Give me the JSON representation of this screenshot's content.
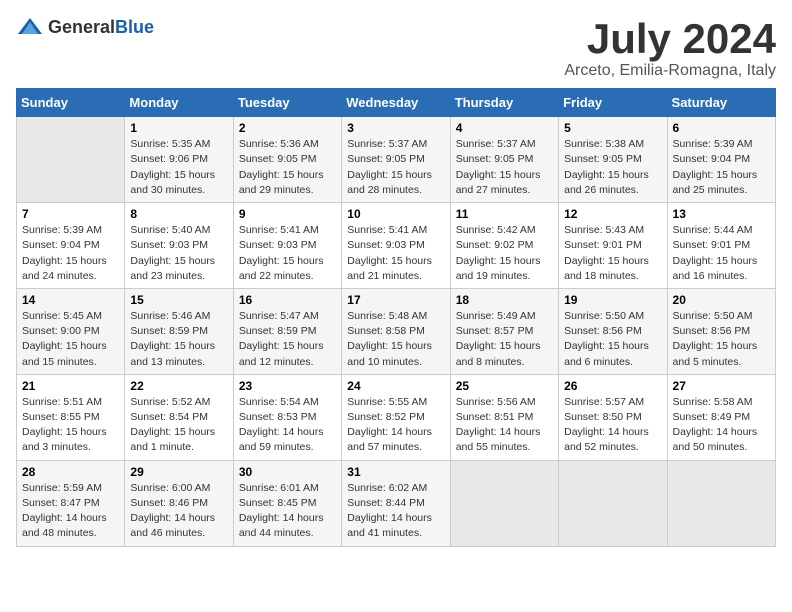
{
  "header": {
    "logo_general": "General",
    "logo_blue": "Blue",
    "month_title": "July 2024",
    "location": "Arceto, Emilia-Romagna, Italy"
  },
  "days_of_week": [
    "Sunday",
    "Monday",
    "Tuesday",
    "Wednesday",
    "Thursday",
    "Friday",
    "Saturday"
  ],
  "weeks": [
    [
      {
        "day": "",
        "empty": true
      },
      {
        "day": "1",
        "sunrise": "Sunrise: 5:35 AM",
        "sunset": "Sunset: 9:06 PM",
        "daylight": "Daylight: 15 hours and 30 minutes."
      },
      {
        "day": "2",
        "sunrise": "Sunrise: 5:36 AM",
        "sunset": "Sunset: 9:05 PM",
        "daylight": "Daylight: 15 hours and 29 minutes."
      },
      {
        "day": "3",
        "sunrise": "Sunrise: 5:37 AM",
        "sunset": "Sunset: 9:05 PM",
        "daylight": "Daylight: 15 hours and 28 minutes."
      },
      {
        "day": "4",
        "sunrise": "Sunrise: 5:37 AM",
        "sunset": "Sunset: 9:05 PM",
        "daylight": "Daylight: 15 hours and 27 minutes."
      },
      {
        "day": "5",
        "sunrise": "Sunrise: 5:38 AM",
        "sunset": "Sunset: 9:05 PM",
        "daylight": "Daylight: 15 hours and 26 minutes."
      },
      {
        "day": "6",
        "sunrise": "Sunrise: 5:39 AM",
        "sunset": "Sunset: 9:04 PM",
        "daylight": "Daylight: 15 hours and 25 minutes."
      }
    ],
    [
      {
        "day": "7",
        "sunrise": "Sunrise: 5:39 AM",
        "sunset": "Sunset: 9:04 PM",
        "daylight": "Daylight: 15 hours and 24 minutes."
      },
      {
        "day": "8",
        "sunrise": "Sunrise: 5:40 AM",
        "sunset": "Sunset: 9:03 PM",
        "daylight": "Daylight: 15 hours and 23 minutes."
      },
      {
        "day": "9",
        "sunrise": "Sunrise: 5:41 AM",
        "sunset": "Sunset: 9:03 PM",
        "daylight": "Daylight: 15 hours and 22 minutes."
      },
      {
        "day": "10",
        "sunrise": "Sunrise: 5:41 AM",
        "sunset": "Sunset: 9:03 PM",
        "daylight": "Daylight: 15 hours and 21 minutes."
      },
      {
        "day": "11",
        "sunrise": "Sunrise: 5:42 AM",
        "sunset": "Sunset: 9:02 PM",
        "daylight": "Daylight: 15 hours and 19 minutes."
      },
      {
        "day": "12",
        "sunrise": "Sunrise: 5:43 AM",
        "sunset": "Sunset: 9:01 PM",
        "daylight": "Daylight: 15 hours and 18 minutes."
      },
      {
        "day": "13",
        "sunrise": "Sunrise: 5:44 AM",
        "sunset": "Sunset: 9:01 PM",
        "daylight": "Daylight: 15 hours and 16 minutes."
      }
    ],
    [
      {
        "day": "14",
        "sunrise": "Sunrise: 5:45 AM",
        "sunset": "Sunset: 9:00 PM",
        "daylight": "Daylight: 15 hours and 15 minutes."
      },
      {
        "day": "15",
        "sunrise": "Sunrise: 5:46 AM",
        "sunset": "Sunset: 8:59 PM",
        "daylight": "Daylight: 15 hours and 13 minutes."
      },
      {
        "day": "16",
        "sunrise": "Sunrise: 5:47 AM",
        "sunset": "Sunset: 8:59 PM",
        "daylight": "Daylight: 15 hours and 12 minutes."
      },
      {
        "day": "17",
        "sunrise": "Sunrise: 5:48 AM",
        "sunset": "Sunset: 8:58 PM",
        "daylight": "Daylight: 15 hours and 10 minutes."
      },
      {
        "day": "18",
        "sunrise": "Sunrise: 5:49 AM",
        "sunset": "Sunset: 8:57 PM",
        "daylight": "Daylight: 15 hours and 8 minutes."
      },
      {
        "day": "19",
        "sunrise": "Sunrise: 5:50 AM",
        "sunset": "Sunset: 8:56 PM",
        "daylight": "Daylight: 15 hours and 6 minutes."
      },
      {
        "day": "20",
        "sunrise": "Sunrise: 5:50 AM",
        "sunset": "Sunset: 8:56 PM",
        "daylight": "Daylight: 15 hours and 5 minutes."
      }
    ],
    [
      {
        "day": "21",
        "sunrise": "Sunrise: 5:51 AM",
        "sunset": "Sunset: 8:55 PM",
        "daylight": "Daylight: 15 hours and 3 minutes."
      },
      {
        "day": "22",
        "sunrise": "Sunrise: 5:52 AM",
        "sunset": "Sunset: 8:54 PM",
        "daylight": "Daylight: 15 hours and 1 minute."
      },
      {
        "day": "23",
        "sunrise": "Sunrise: 5:54 AM",
        "sunset": "Sunset: 8:53 PM",
        "daylight": "Daylight: 14 hours and 59 minutes."
      },
      {
        "day": "24",
        "sunrise": "Sunrise: 5:55 AM",
        "sunset": "Sunset: 8:52 PM",
        "daylight": "Daylight: 14 hours and 57 minutes."
      },
      {
        "day": "25",
        "sunrise": "Sunrise: 5:56 AM",
        "sunset": "Sunset: 8:51 PM",
        "daylight": "Daylight: 14 hours and 55 minutes."
      },
      {
        "day": "26",
        "sunrise": "Sunrise: 5:57 AM",
        "sunset": "Sunset: 8:50 PM",
        "daylight": "Daylight: 14 hours and 52 minutes."
      },
      {
        "day": "27",
        "sunrise": "Sunrise: 5:58 AM",
        "sunset": "Sunset: 8:49 PM",
        "daylight": "Daylight: 14 hours and 50 minutes."
      }
    ],
    [
      {
        "day": "28",
        "sunrise": "Sunrise: 5:59 AM",
        "sunset": "Sunset: 8:47 PM",
        "daylight": "Daylight: 14 hours and 48 minutes."
      },
      {
        "day": "29",
        "sunrise": "Sunrise: 6:00 AM",
        "sunset": "Sunset: 8:46 PM",
        "daylight": "Daylight: 14 hours and 46 minutes."
      },
      {
        "day": "30",
        "sunrise": "Sunrise: 6:01 AM",
        "sunset": "Sunset: 8:45 PM",
        "daylight": "Daylight: 14 hours and 44 minutes."
      },
      {
        "day": "31",
        "sunrise": "Sunrise: 6:02 AM",
        "sunset": "Sunset: 8:44 PM",
        "daylight": "Daylight: 14 hours and 41 minutes."
      },
      {
        "day": "",
        "empty": true
      },
      {
        "day": "",
        "empty": true
      },
      {
        "day": "",
        "empty": true
      }
    ]
  ]
}
